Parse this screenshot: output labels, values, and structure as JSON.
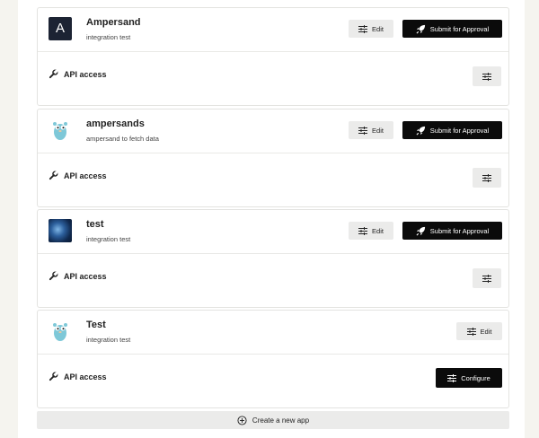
{
  "apps": [
    {
      "name": "Ampersand",
      "description": "integration test",
      "logo": "letter-a-logo",
      "logo_letter": "A",
      "edit_label": "Edit",
      "submit_label": "Submit for Approval",
      "api_label": "API access"
    },
    {
      "name": "ampersands",
      "description": "ampersand to fetch data",
      "logo": "gopher-logo",
      "edit_label": "Edit",
      "submit_label": "Submit for Approval",
      "api_label": "API access"
    },
    {
      "name": "test",
      "description": "integration test",
      "logo": "photo-logo",
      "edit_label": "Edit",
      "submit_label": "Submit for Approval",
      "api_label": "API access"
    },
    {
      "name": "Test",
      "description": "integration test",
      "logo": "gopher-logo",
      "edit_label": "Edit",
      "api_label": "API access",
      "configure_label": "Configure"
    }
  ],
  "create_label": "Create a new app",
  "colors": {
    "dark_button": "#0b0b0b",
    "light_button": "#ebebea",
    "background": "#f5f4ef"
  }
}
